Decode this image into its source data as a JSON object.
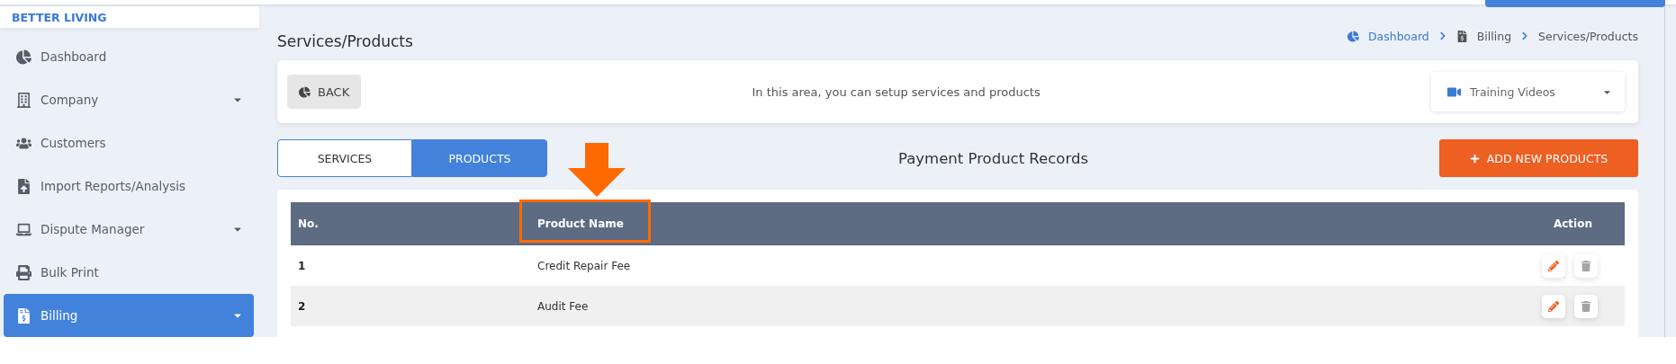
{
  "brand": "BETTER LIVING",
  "sidebar": {
    "items": [
      {
        "label": "Dashboard",
        "expandable": false,
        "selected": false
      },
      {
        "label": "Company",
        "expandable": true,
        "selected": false
      },
      {
        "label": "Customers",
        "expandable": false,
        "selected": false
      },
      {
        "label": "Import Reports/Analysis",
        "expandable": false,
        "selected": false
      },
      {
        "label": "Dispute Manager",
        "expandable": true,
        "selected": false
      },
      {
        "label": "Bulk Print",
        "expandable": false,
        "selected": false
      },
      {
        "label": "Billing",
        "expandable": true,
        "selected": true
      }
    ]
  },
  "page_title": "Services/Products",
  "breadcrumb": [
    {
      "label": "Dashboard",
      "kind": "link"
    },
    {
      "label": "Billing",
      "kind": "item"
    },
    {
      "label": "Services/Products",
      "kind": "current"
    }
  ],
  "info_bar": {
    "back_button": "BACK",
    "message": "In this area, you can setup services and products",
    "dropdown": "Training Videos"
  },
  "tabs": [
    {
      "label": "SERVICES",
      "selected": false
    },
    {
      "label": "PRODUCTS",
      "selected": true
    }
  ],
  "section_title": "Payment Product Records",
  "add_button": "ADD NEW PRODUCTS",
  "table": {
    "columns": [
      "No.",
      "Product Name",
      "Action"
    ],
    "rows": [
      {
        "no": "1",
        "name": "Credit Repair Fee"
      },
      {
        "no": "2",
        "name": "Audit Fee"
      }
    ]
  }
}
